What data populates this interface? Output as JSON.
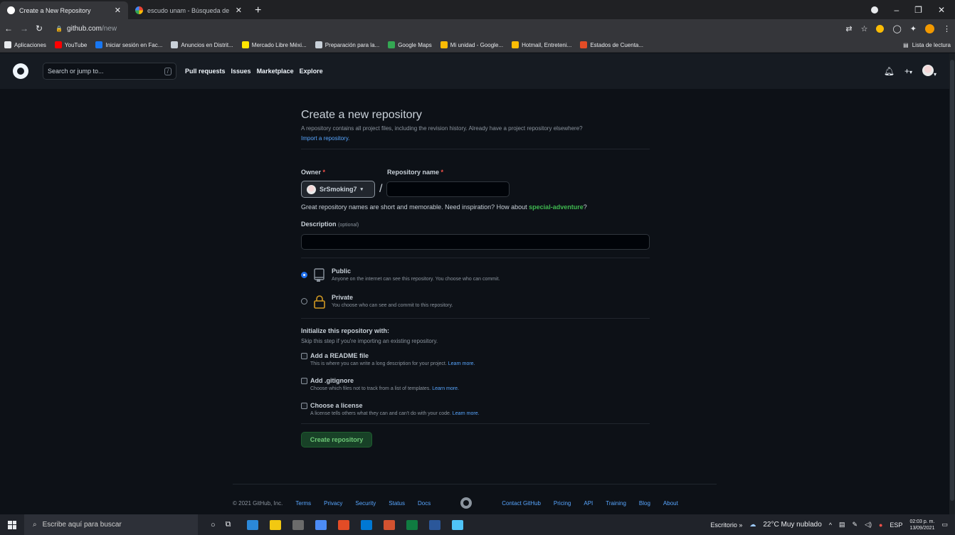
{
  "browser": {
    "tabs": [
      {
        "title": "Create a New Repository",
        "active": true
      },
      {
        "title": "escudo unam - Búsqueda de Go",
        "active": false
      }
    ],
    "address_host": "github.com",
    "address_path": "/new",
    "reading_list": "Lista de lectura",
    "bookmarks": [
      {
        "label": "Aplicaciones",
        "color": "#e8eaed"
      },
      {
        "label": "YouTube",
        "color": "#ff0000"
      },
      {
        "label": "Iniciar sesión en Fac...",
        "color": "#1877f2"
      },
      {
        "label": "Anuncios en Distrit...",
        "color": "#c9d1d9"
      },
      {
        "label": "Mercado Libre Méxi...",
        "color": "#ffe600"
      },
      {
        "label": "Preparación para la...",
        "color": "#c9d1d9"
      },
      {
        "label": "Google Maps",
        "color": "#34a853"
      },
      {
        "label": "Mi unidad - Google...",
        "color": "#fbbc05"
      },
      {
        "label": "Hotmail, Entreteni...",
        "color": "#fbbc05"
      },
      {
        "label": "Estados de Cuenta...",
        "color": "#e34c26"
      }
    ]
  },
  "header": {
    "search_placeholder": "Search or jump to...",
    "search_shortcut": "/",
    "nav": [
      "Pull requests",
      "Issues",
      "Marketplace",
      "Explore"
    ],
    "plus": "+",
    "caret": "▾"
  },
  "form": {
    "title": "Create a new repository",
    "subtitle": "A repository contains all project files, including the revision history. Already have a project repository elsewhere?",
    "import_link": "Import a repository.",
    "owner_label": "Owner",
    "repo_label": "Repository name",
    "required_mark": "*",
    "owner_value": "SrSmoking7",
    "owner_caret": "▾",
    "separator": "/",
    "repo_value": "",
    "hint_prefix": "Great repository names are short and memorable. Need inspiration? How about ",
    "hint_suggestion": "special-adventure",
    "hint_suffix": "?",
    "description_label": "Description",
    "description_optional": "(optional)",
    "description_value": "",
    "visibility": [
      {
        "title": "Public",
        "desc": "Anyone on the internet can see this repository. You choose who can commit.",
        "selected": true
      },
      {
        "title": "Private",
        "desc": "You choose who can see and commit to this repository.",
        "selected": false
      }
    ],
    "init_title": "Initialize this repository with:",
    "init_sub": "Skip this step if you're importing an existing repository.",
    "checkboxes": [
      {
        "label": "Add a README file",
        "desc": "This is where you can write a long description for your project.",
        "link": "Learn more."
      },
      {
        "label": "Add .gitignore",
        "desc": "Choose which files not to track from a list of templates.",
        "link": "Learn more."
      },
      {
        "label": "Choose a license",
        "desc": "A license tells others what they can and can't do with your code.",
        "link": "Learn more."
      }
    ],
    "create_button": "Create repository"
  },
  "footer": {
    "copyright": "© 2021 GitHub, Inc.",
    "left_links": [
      "Terms",
      "Privacy",
      "Security",
      "Status",
      "Docs"
    ],
    "right_links": [
      "Contact GitHub",
      "Pricing",
      "API",
      "Training",
      "Blog",
      "About"
    ]
  },
  "taskbar": {
    "search_placeholder": "Escribe aquí para buscar",
    "desktop": "Escritorio",
    "overflow": "»",
    "weather": "22°C Muy nublado",
    "lang": "ESP",
    "time": "02:03 p. m.",
    "date": "13/09/2021",
    "app_colors": [
      "#2b88d8",
      "#f2c811",
      "#6b6b6b",
      "#4c8bf5",
      "#e34c26",
      "#0078d4",
      "#d35230",
      "#107c41",
      "#2b579a",
      "#4fc3f7"
    ]
  },
  "colors": {
    "accent_blue": "#58a6ff",
    "suggestion_green": "#3fb950",
    "required_red": "#f85149",
    "create_button_green": "#238636"
  }
}
